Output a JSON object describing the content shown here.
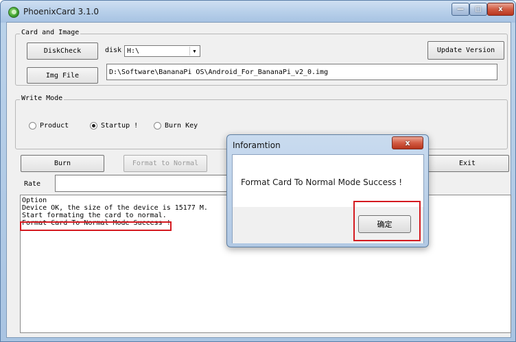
{
  "window": {
    "title": "PhoenixCard 3.1.0",
    "min_glyph": "—",
    "max_glyph": "□",
    "close_glyph": "x",
    "app_icon": "phoenixcard-icon"
  },
  "card_image": {
    "group_label": "Card and Image",
    "diskcheck_label": "DiskCheck",
    "disk_label": "disk",
    "disk_value": "H:\\",
    "update_label": "Update Version",
    "imgfile_label": "Img File",
    "img_path": "D:\\Software\\BananaPi OS\\Android_For_BananaPi_v2_0.img"
  },
  "write_mode": {
    "group_label": "Write Mode",
    "options": [
      {
        "label": "Product",
        "checked": false
      },
      {
        "label": "Startup !",
        "checked": true
      },
      {
        "label": "Burn Key",
        "checked": false
      }
    ]
  },
  "actions": {
    "burn_label": "Burn",
    "format_label": "Format to Normal",
    "exit_label": "Exit",
    "rate_label": "Rate"
  },
  "log": {
    "header": "Option",
    "lines": [
      "Device OK, the size of the device is 15177 M.",
      "Start formating the card to normal.",
      "Format Card To Normal Mode Success !"
    ]
  },
  "dialog": {
    "title": "Inforamtion",
    "close_glyph": "x",
    "message": "Format Card To Normal Mode Success !",
    "ok_label": "确定"
  },
  "colors": {
    "highlight": "#d4191f"
  }
}
